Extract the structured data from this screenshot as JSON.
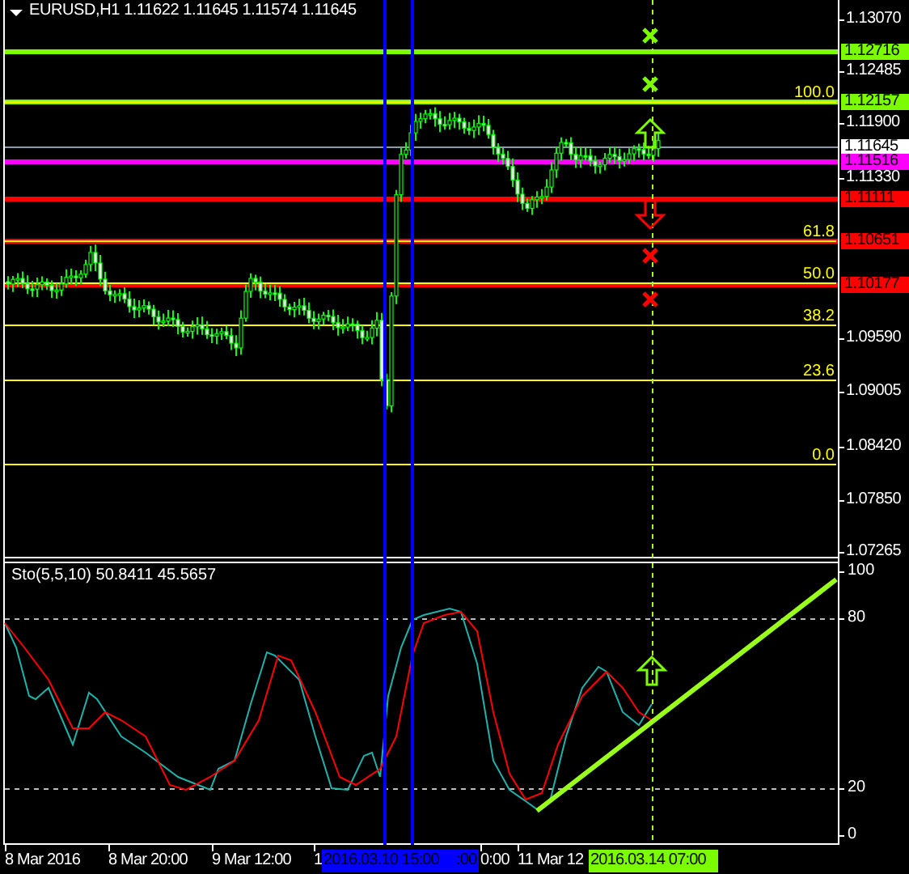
{
  "header": {
    "symbol": "EURUSD,H1",
    "prices": "1.11622 1.11645 1.11574 1.11645"
  },
  "price_axis": {
    "ticks": [
      "1.13070",
      "1.12485",
      "1.11900",
      "1.11330",
      "1.09590",
      "1.09005",
      "1.08420",
      "1.07850",
      "1.07265"
    ]
  },
  "price_levels": [
    {
      "label": "1.12716",
      "kind": "level",
      "color": "#7cfc00"
    },
    {
      "label": "1.12157",
      "kind": "level",
      "color": "#7cfc00"
    },
    {
      "label": "1.11645",
      "kind": "current",
      "color": "#ffffff"
    },
    {
      "label": "1.11516",
      "kind": "level",
      "color": "#ff00ff"
    },
    {
      "label": "1.11111",
      "kind": "level",
      "color": "#ff0000"
    },
    {
      "label": "1.10651",
      "kind": "level",
      "color": "#ff0000"
    },
    {
      "label": "1.10177",
      "kind": "level",
      "color": "#ff0000"
    }
  ],
  "fibonacci": {
    "levels": [
      "100.0",
      "61.8",
      "50.0",
      "38.2",
      "23.6",
      "0.0"
    ]
  },
  "signals": [
    {
      "kind": "cross",
      "color": "#7cfc00"
    },
    {
      "kind": "cross",
      "color": "#7cfc00"
    },
    {
      "kind": "up",
      "color": "#7cfc00"
    },
    {
      "kind": "down",
      "color": "#ff0000"
    },
    {
      "kind": "cross",
      "color": "#ff0000"
    },
    {
      "kind": "cross",
      "color": "#ff0000"
    },
    {
      "kind": "up",
      "color": "#7cfc00"
    }
  ],
  "stochastic": {
    "label": "Sto(5,5,10) 50.8411 45.5657",
    "axis": [
      "100",
      "80",
      "20",
      "0"
    ]
  },
  "time_axis": {
    "labels": [
      "8 Mar 2016",
      "8 Mar 20:00",
      "9 Mar 12:00",
      "1",
      "0:00",
      "11 Mar 12"
    ]
  },
  "time_markers": [
    {
      "label": "2016.03.10 15:00",
      "color": "#0000ff"
    },
    {
      "label": ":00",
      "color": "#0000ff"
    },
    {
      "label": "2016.03.14 07:00",
      "color": "#7cfc00"
    }
  ]
}
